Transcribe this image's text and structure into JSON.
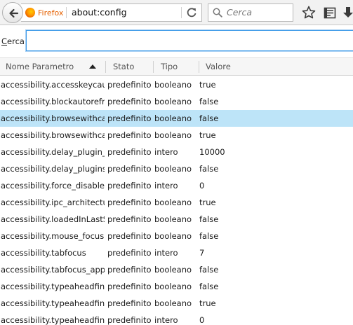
{
  "navbar": {
    "identity_label": "Firefox",
    "url": "about:config",
    "search_placeholder": "Cerca"
  },
  "filter": {
    "label_accesskey": "C",
    "label_rest": "erca:",
    "value": ""
  },
  "table": {
    "columns": [
      "Nome Parametro",
      "Stato",
      "Tipo",
      "Valore"
    ],
    "sort_column": "Nome Parametro",
    "sort_direction": "ascending",
    "selected_row": 2,
    "rows": [
      {
        "name": "accessibility.accesskeycau…",
        "stato": "predefinito",
        "tipo": "booleano",
        "valore": "true"
      },
      {
        "name": "accessibility.blockautorefr…",
        "stato": "predefinito",
        "tipo": "booleano",
        "valore": "false"
      },
      {
        "name": "accessibility.browsewithca…",
        "stato": "predefinito",
        "tipo": "booleano",
        "valore": "false"
      },
      {
        "name": "accessibility.browsewithca…",
        "stato": "predefinito",
        "tipo": "booleano",
        "valore": "true"
      },
      {
        "name": "accessibility.delay_plugin_…",
        "stato": "predefinito",
        "tipo": "intero",
        "valore": "10000"
      },
      {
        "name": "accessibility.delay_plugins",
        "stato": "predefinito",
        "tipo": "booleano",
        "valore": "false"
      },
      {
        "name": "accessibility.force_disabled",
        "stato": "predefinito",
        "tipo": "intero",
        "valore": "0"
      },
      {
        "name": "accessibility.ipc_architectu…",
        "stato": "predefinito",
        "tipo": "booleano",
        "valore": "true"
      },
      {
        "name": "accessibility.loadedInLastS…",
        "stato": "predefinito",
        "tipo": "booleano",
        "valore": "false"
      },
      {
        "name": "accessibility.mouse_focus…",
        "stato": "predefinito",
        "tipo": "booleano",
        "valore": "false"
      },
      {
        "name": "accessibility.tabfocus",
        "stato": "predefinito",
        "tipo": "intero",
        "valore": "7"
      },
      {
        "name": "accessibility.tabfocus_appl…",
        "stato": "predefinito",
        "tipo": "booleano",
        "valore": "false"
      },
      {
        "name": "accessibility.typeaheadfind",
        "stato": "predefinito",
        "tipo": "booleano",
        "valore": "false"
      },
      {
        "name": "accessibility.typeaheadfin…",
        "stato": "predefinito",
        "tipo": "booleano",
        "valore": "true"
      },
      {
        "name": "accessibility.typeaheadfin…",
        "stato": "predefinito",
        "tipo": "intero",
        "valore": "0"
      }
    ]
  },
  "icons": {
    "back": "back-arrow-icon",
    "identity": "firefox-logo-icon",
    "reload": "reload-icon",
    "search": "magnifier-icon",
    "bookmark": "star-icon",
    "reading_list": "reading-list-icon",
    "downloads": "download-arrow-icon"
  },
  "colors": {
    "selected_row": "#bde4f8",
    "focus_border": "#3d9ae8",
    "identity_label": "#e66000"
  }
}
